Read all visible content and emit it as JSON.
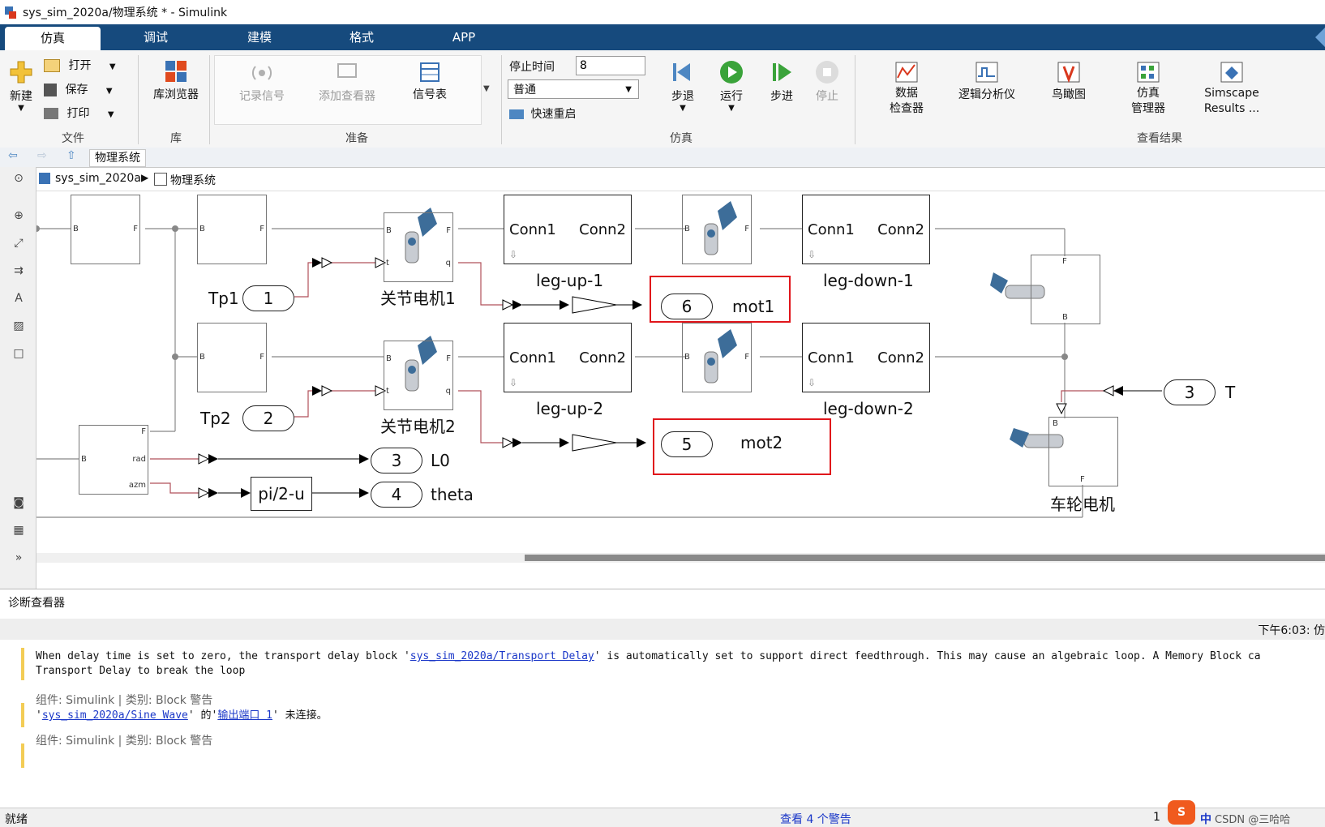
{
  "window": {
    "title": "sys_sim_2020a/物理系统 * - Simulink"
  },
  "tabs": [
    "仿真",
    "调试",
    "建模",
    "格式",
    "APP"
  ],
  "ribbon": {
    "file": {
      "new": "新建",
      "open": "打开",
      "save": "保存",
      "print": "打印",
      "group": "文件"
    },
    "library": {
      "browser": "库浏览器",
      "group": "库"
    },
    "prepare": {
      "record": "记录信号",
      "add_viewer": "添加查看器",
      "signal_table": "信号表",
      "group": "准备"
    },
    "simulate": {
      "stop_time_label": "停止时间",
      "stop_time_value": "8",
      "mode": "普通",
      "fast_restart": "快速重启",
      "step_back": "步退",
      "run": "运行",
      "step_forward": "步进",
      "stop": "停止",
      "group": "仿真"
    },
    "results": {
      "data_inspector_1": "数据",
      "data_inspector_2": "检查器",
      "logic_analyzer": "逻辑分析仪",
      "birdseye": "鸟瞰图",
      "sim_manager_1": "仿真",
      "sim_manager_2": "管理器",
      "simscape_1": "Simscape",
      "simscape_2": "Results ...",
      "group": "查看结果"
    }
  },
  "address": {
    "current": "物理系统"
  },
  "breadcrumb": {
    "root": "sys_sim_2020a",
    "child": "物理系统"
  },
  "canvas": {
    "tp1": "Tp1",
    "tp2": "Tp2",
    "port1": "1",
    "port2": "2",
    "port3_in": "3",
    "T": "T",
    "motor1": "关节电机1",
    "motor2": "关节电机2",
    "wheel_motor": "车轮电机",
    "conn1": "Conn1",
    "conn2": "Conn2",
    "leg_up_1": "leg-up-1",
    "leg_up_2": "leg-up-2",
    "leg_down_1": "leg-down-1",
    "leg_down_2": "leg-down-2",
    "out6": "6",
    "mot1": "mot1",
    "out5": "5",
    "mot2": "mot2",
    "out3": "3",
    "L0": "L0",
    "out4": "4",
    "theta": "theta",
    "fcn": "pi/2-u",
    "port_B": "B",
    "port_F": "F",
    "port_t": "t",
    "port_q": "q",
    "port_rad": "rad",
    "port_azm": "azm"
  },
  "diagnostics": {
    "title": "诊断查看器",
    "timestamp": "下午6:03: 仿",
    "msg1_pre": "When delay time is set to zero, the transport delay block '",
    "msg1_link": "sys_sim_2020a/Transport Delay",
    "msg1_post": "' is automatically set to support direct feedthrough. This may cause an algebraic loop. A Memory Block ca",
    "msg1_line2": "Transport Delay to break the loop",
    "meta1": "组件: Simulink | 类别: Block 警告",
    "msg2_pre": "'",
    "msg2_link": "sys_sim_2020a/Sine Wave",
    "msg2_mid": "' 的'",
    "msg2_link2": "输出端口 1",
    "msg2_post": "' 未连接。",
    "meta2": "组件: Simulink | 类别: Block 警告"
  },
  "status": {
    "left": "就绪",
    "center": "查看 4 个警告",
    "right": "1",
    "watermark": "CSDN @三哈哈"
  }
}
